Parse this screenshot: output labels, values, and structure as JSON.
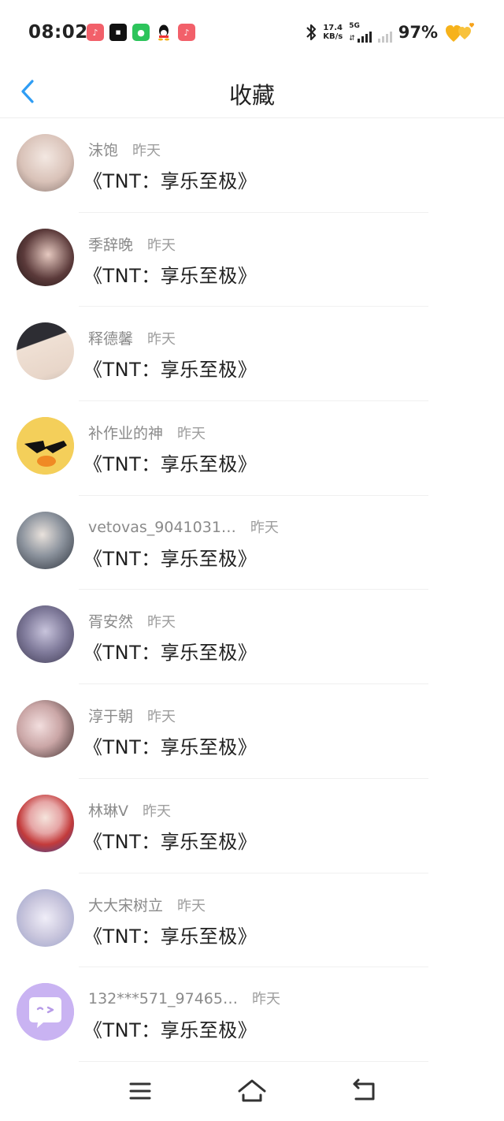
{
  "status_bar": {
    "time": "08:02",
    "net_speed_value": "17.4",
    "net_speed_unit": "KB/s",
    "network_type": "5G",
    "battery": "97%"
  },
  "header": {
    "title": "收藏",
    "accent_color": "#2f9df4"
  },
  "favorites": [
    {
      "user": "沫饱",
      "time": "昨天",
      "content": "《TNT：享乐至极》",
      "avatar_color": "#d9c2b8"
    },
    {
      "user": "季辞晚",
      "time": "昨天",
      "content": "《TNT：享乐至极》",
      "avatar_color": "#5b3a3a"
    },
    {
      "user": "释德馨",
      "time": "昨天",
      "content": "《TNT：享乐至极》",
      "avatar_color": "#e8d6c9"
    },
    {
      "user": "补作业的神",
      "time": "昨天",
      "content": "《TNT：享乐至极》",
      "avatar_color": "#f2c84b"
    },
    {
      "user": "vetovas_9041031…",
      "time": "昨天",
      "content": "《TNT：享乐至极》",
      "avatar_color": "#4a5260"
    },
    {
      "user": "胥安然",
      "time": "昨天",
      "content": "《TNT：享乐至极》",
      "avatar_color": "#7f7a9a"
    },
    {
      "user": "淳于朝",
      "time": "昨天",
      "content": "《TNT：享乐至极》",
      "avatar_color": "#caa6a6"
    },
    {
      "user": "林琳V",
      "time": "昨天",
      "content": "《TNT：享乐至极》",
      "avatar_color": "#c33a3a"
    },
    {
      "user": "大大宋树立",
      "time": "昨天",
      "content": "《TNT：享乐至极》",
      "avatar_color": "#c9c6dd"
    },
    {
      "user": "132***571_97465…",
      "time": "昨天",
      "content": "《TNT：享乐至极》",
      "avatar_color": "#c9b3f2"
    }
  ]
}
